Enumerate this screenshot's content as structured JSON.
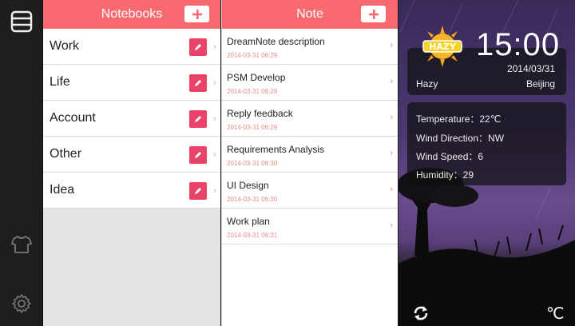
{
  "notebooks": {
    "title": "Notebooks",
    "items": [
      {
        "label": "Work"
      },
      {
        "label": "Life"
      },
      {
        "label": "Account"
      },
      {
        "label": "Other"
      },
      {
        "label": "Idea"
      }
    ]
  },
  "notes": {
    "title": "Note",
    "items": [
      {
        "title": "DreamNote description",
        "date": "2014-03-31 06:29"
      },
      {
        "title": "PSM Develop",
        "date": "2014-03-31 06:29"
      },
      {
        "title": "Reply feedback",
        "date": "2014-03-31 06:29"
      },
      {
        "title": "Requirements Analysis",
        "date": "2014-03-31 06:30"
      },
      {
        "title": "UI Design",
        "date": "2014-03-31 06:30"
      },
      {
        "title": "Work plan",
        "date": "2014-03-31 06:31"
      }
    ]
  },
  "weather": {
    "badge": "HAZY",
    "time": "15:00",
    "date": "2014/03/31",
    "condition": "Hazy",
    "city": "Beijing",
    "temperature": "Temperature：22℃",
    "wind_direction": "Wind Direction：NW",
    "wind_speed": "Wind Speed：6",
    "humidity": "Humidity：29",
    "unit_button": "℃"
  },
  "colors": {
    "accent": "#f86a6f",
    "edit": "#e9436a",
    "date_text": "#e88a8a"
  },
  "icons": {
    "rail": [
      "menu-icon",
      "shirt-icon",
      "gear-icon"
    ],
    "weather": [
      "sun-icon",
      "refresh-icon"
    ]
  }
}
